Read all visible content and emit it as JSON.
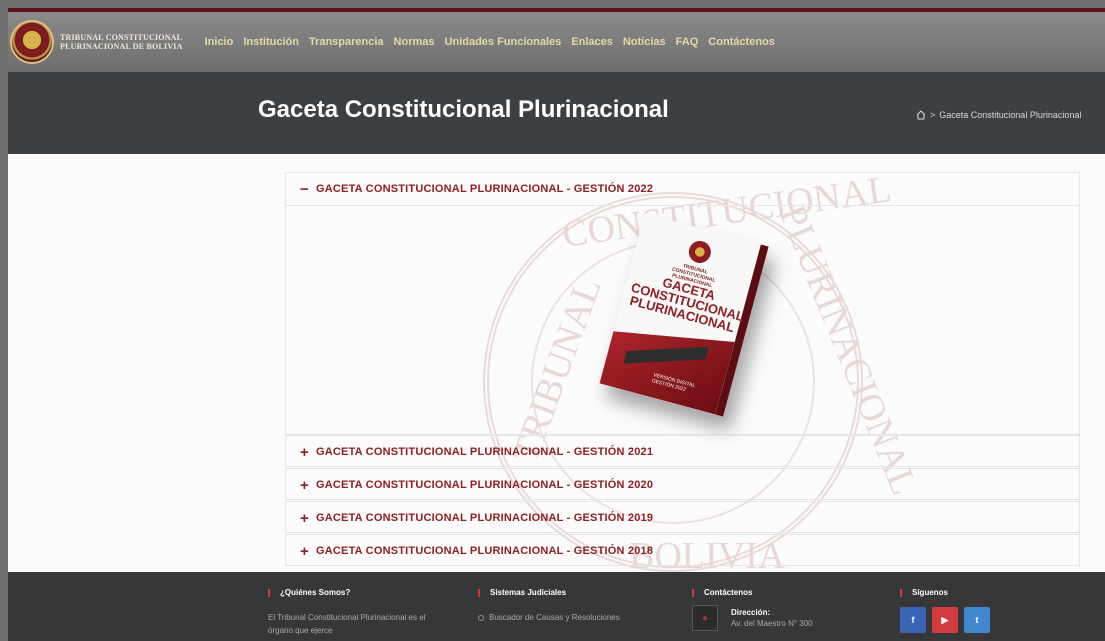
{
  "header": {
    "logo_text_line1": "TRIBUNAL CONSTITUCIONAL",
    "logo_text_line2": "PLURINACIONAL DE BOLIVIA",
    "nav": [
      "Inicio",
      "Institución",
      "Transparencia",
      "Normas",
      "Unidades Funcionales",
      "Enlaces",
      "Noticias",
      "FAQ",
      "Contáctenos"
    ]
  },
  "hero": {
    "title": "Gaceta Constitucional Plurinacional",
    "breadcrumb_icon": "home-icon",
    "breadcrumb_separator": ">",
    "breadcrumb_current": "Gaceta Constitucional Plurinacional"
  },
  "accordion": [
    {
      "sign": "−",
      "title": "GACETA CONSTITUCIONAL PLURINACIONAL - GESTIÓN 2022",
      "expanded": true
    },
    {
      "sign": "+",
      "title": "GACETA CONSTITUCIONAL PLURINACIONAL - GESTIÓN 2021",
      "expanded": false
    },
    {
      "sign": "+",
      "title": "GACETA CONSTITUCIONAL PLURINACIONAL - GESTIÓN 2020",
      "expanded": false
    },
    {
      "sign": "+",
      "title": "GACETA CONSTITUCIONAL PLURINACIONAL - GESTIÓN 2019",
      "expanded": false
    },
    {
      "sign": "+",
      "title": "GACETA CONSTITUCIONAL PLURINACIONAL - GESTIÓN 2018",
      "expanded": false
    }
  ],
  "book": {
    "small_text": "TRIBUNAL CONSTITUCIONAL PLURINACIONAL",
    "title": "GACETA CONSTITUCIONAL PLURINACIONAL",
    "bottom_text": "VERSIÓN DIGITAL GESTIÓN 2022"
  },
  "watermark": {
    "top": "CONSTITUCIONAL",
    "left": "TRIBUNAL",
    "right": "PLURINACIONAL",
    "bottom": "BOLIVIA"
  },
  "footer": {
    "quienes": {
      "title": "¿Quiénes Somos?",
      "text": "El Tribunal Constitucional Plurinacional es el órgano que ejerce"
    },
    "sistemas": {
      "title": "Sistemas Judiciales",
      "item": "Buscador de Causas y Resoluciones"
    },
    "contactenos": {
      "title": "Contáctenos",
      "address_label": "Dirección:",
      "address": "Av. del Maestro N° 300"
    },
    "siguenos": {
      "title": "Síguenos"
    }
  },
  "colors": {
    "brand": "#8e1f24",
    "header_bg": "#777777",
    "hero_bg": "#3d4043",
    "footer_bg": "#353739",
    "facebook": "#3b63b8",
    "youtube": "#d13d3f",
    "twitter": "#3f87cf"
  }
}
